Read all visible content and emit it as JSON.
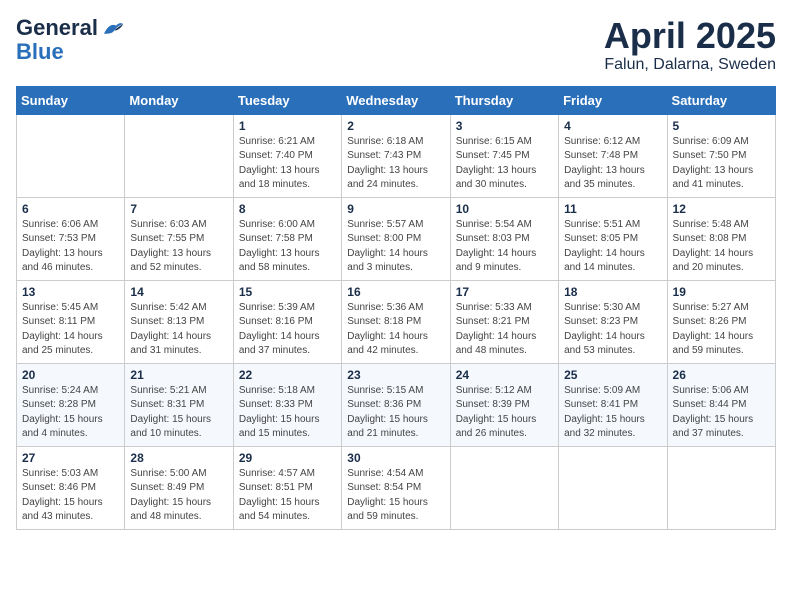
{
  "logo": {
    "general": "General",
    "blue": "Blue"
  },
  "header": {
    "month_year": "April 2025",
    "location": "Falun, Dalarna, Sweden"
  },
  "days_of_week": [
    "Sunday",
    "Monday",
    "Tuesday",
    "Wednesday",
    "Thursday",
    "Friday",
    "Saturday"
  ],
  "weeks": [
    [
      {
        "day": "",
        "info": ""
      },
      {
        "day": "",
        "info": ""
      },
      {
        "day": "1",
        "info": "Sunrise: 6:21 AM\nSunset: 7:40 PM\nDaylight: 13 hours and 18 minutes."
      },
      {
        "day": "2",
        "info": "Sunrise: 6:18 AM\nSunset: 7:43 PM\nDaylight: 13 hours and 24 minutes."
      },
      {
        "day": "3",
        "info": "Sunrise: 6:15 AM\nSunset: 7:45 PM\nDaylight: 13 hours and 30 minutes."
      },
      {
        "day": "4",
        "info": "Sunrise: 6:12 AM\nSunset: 7:48 PM\nDaylight: 13 hours and 35 minutes."
      },
      {
        "day": "5",
        "info": "Sunrise: 6:09 AM\nSunset: 7:50 PM\nDaylight: 13 hours and 41 minutes."
      }
    ],
    [
      {
        "day": "6",
        "info": "Sunrise: 6:06 AM\nSunset: 7:53 PM\nDaylight: 13 hours and 46 minutes."
      },
      {
        "day": "7",
        "info": "Sunrise: 6:03 AM\nSunset: 7:55 PM\nDaylight: 13 hours and 52 minutes."
      },
      {
        "day": "8",
        "info": "Sunrise: 6:00 AM\nSunset: 7:58 PM\nDaylight: 13 hours and 58 minutes."
      },
      {
        "day": "9",
        "info": "Sunrise: 5:57 AM\nSunset: 8:00 PM\nDaylight: 14 hours and 3 minutes."
      },
      {
        "day": "10",
        "info": "Sunrise: 5:54 AM\nSunset: 8:03 PM\nDaylight: 14 hours and 9 minutes."
      },
      {
        "day": "11",
        "info": "Sunrise: 5:51 AM\nSunset: 8:05 PM\nDaylight: 14 hours and 14 minutes."
      },
      {
        "day": "12",
        "info": "Sunrise: 5:48 AM\nSunset: 8:08 PM\nDaylight: 14 hours and 20 minutes."
      }
    ],
    [
      {
        "day": "13",
        "info": "Sunrise: 5:45 AM\nSunset: 8:11 PM\nDaylight: 14 hours and 25 minutes."
      },
      {
        "day": "14",
        "info": "Sunrise: 5:42 AM\nSunset: 8:13 PM\nDaylight: 14 hours and 31 minutes."
      },
      {
        "day": "15",
        "info": "Sunrise: 5:39 AM\nSunset: 8:16 PM\nDaylight: 14 hours and 37 minutes."
      },
      {
        "day": "16",
        "info": "Sunrise: 5:36 AM\nSunset: 8:18 PM\nDaylight: 14 hours and 42 minutes."
      },
      {
        "day": "17",
        "info": "Sunrise: 5:33 AM\nSunset: 8:21 PM\nDaylight: 14 hours and 48 minutes."
      },
      {
        "day": "18",
        "info": "Sunrise: 5:30 AM\nSunset: 8:23 PM\nDaylight: 14 hours and 53 minutes."
      },
      {
        "day": "19",
        "info": "Sunrise: 5:27 AM\nSunset: 8:26 PM\nDaylight: 14 hours and 59 minutes."
      }
    ],
    [
      {
        "day": "20",
        "info": "Sunrise: 5:24 AM\nSunset: 8:28 PM\nDaylight: 15 hours and 4 minutes."
      },
      {
        "day": "21",
        "info": "Sunrise: 5:21 AM\nSunset: 8:31 PM\nDaylight: 15 hours and 10 minutes."
      },
      {
        "day": "22",
        "info": "Sunrise: 5:18 AM\nSunset: 8:33 PM\nDaylight: 15 hours and 15 minutes."
      },
      {
        "day": "23",
        "info": "Sunrise: 5:15 AM\nSunset: 8:36 PM\nDaylight: 15 hours and 21 minutes."
      },
      {
        "day": "24",
        "info": "Sunrise: 5:12 AM\nSunset: 8:39 PM\nDaylight: 15 hours and 26 minutes."
      },
      {
        "day": "25",
        "info": "Sunrise: 5:09 AM\nSunset: 8:41 PM\nDaylight: 15 hours and 32 minutes."
      },
      {
        "day": "26",
        "info": "Sunrise: 5:06 AM\nSunset: 8:44 PM\nDaylight: 15 hours and 37 minutes."
      }
    ],
    [
      {
        "day": "27",
        "info": "Sunrise: 5:03 AM\nSunset: 8:46 PM\nDaylight: 15 hours and 43 minutes."
      },
      {
        "day": "28",
        "info": "Sunrise: 5:00 AM\nSunset: 8:49 PM\nDaylight: 15 hours and 48 minutes."
      },
      {
        "day": "29",
        "info": "Sunrise: 4:57 AM\nSunset: 8:51 PM\nDaylight: 15 hours and 54 minutes."
      },
      {
        "day": "30",
        "info": "Sunrise: 4:54 AM\nSunset: 8:54 PM\nDaylight: 15 hours and 59 minutes."
      },
      {
        "day": "",
        "info": ""
      },
      {
        "day": "",
        "info": ""
      },
      {
        "day": "",
        "info": ""
      }
    ]
  ]
}
